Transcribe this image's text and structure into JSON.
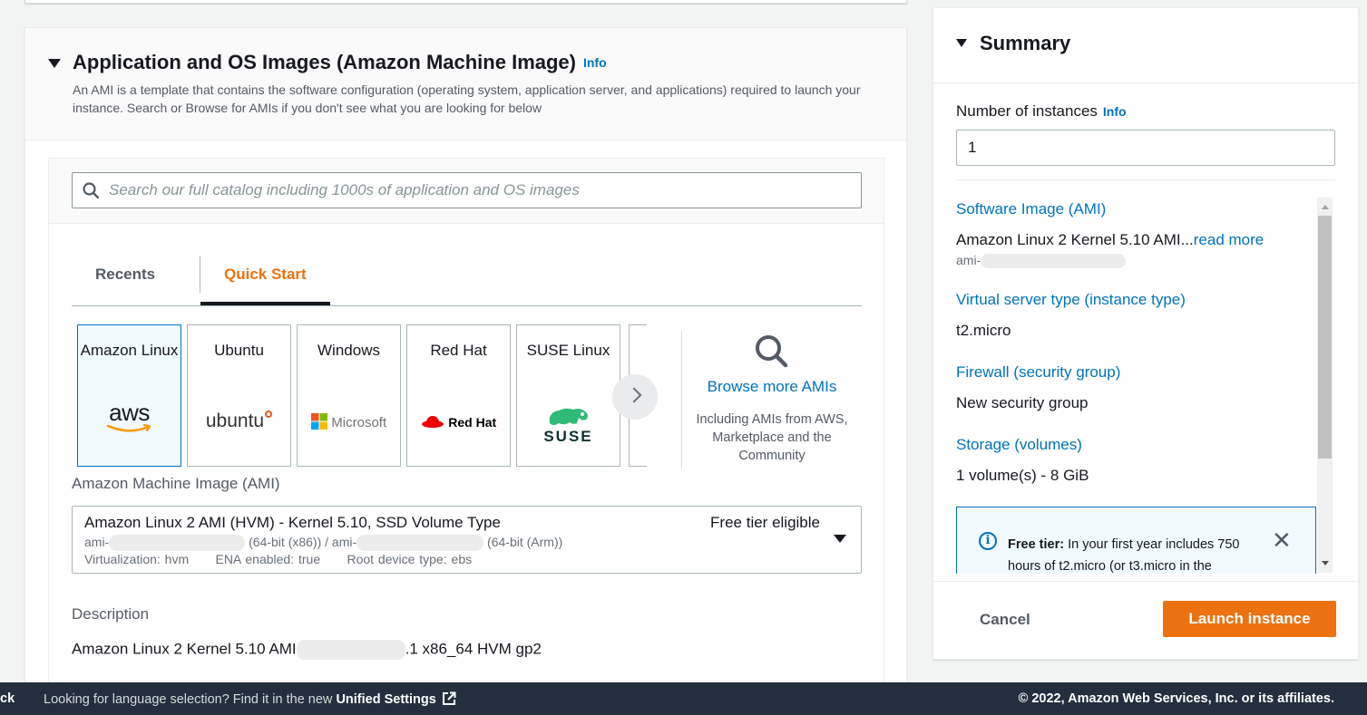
{
  "ami_section": {
    "title": "Application and OS Images (Amazon Machine Image)",
    "info": "Info",
    "description": "An AMI is a template that contains the software configuration (operating system, application server, and applications) required to launch your instance. Search or Browse for AMIs if you don't see what you are looking for below",
    "search_placeholder": "Search our full catalog including 1000s of application and OS images",
    "tabs": [
      {
        "label": "Recents"
      },
      {
        "label": "Quick Start"
      }
    ],
    "os_cards": [
      {
        "name": "Amazon Linux",
        "logo": "aws"
      },
      {
        "name": "Ubuntu",
        "logo": "ubuntu"
      },
      {
        "name": "Windows",
        "logo": "Microsoft"
      },
      {
        "name": "Red Hat",
        "logo": "Red Hat"
      },
      {
        "name": "SUSE Linux",
        "logo": "SUSE"
      }
    ],
    "browse": {
      "link": "Browse more AMIs",
      "sub": "Including AMIs from AWS, Marketplace and the Community"
    },
    "ami_label": "Amazon Machine Image (AMI)",
    "ami_select": {
      "title": "Amazon Linux 2 AMI (HVM) - Kernel 5.10, SSD Volume Type",
      "badge": "Free tier eligible",
      "id_prefix_1": "ami-",
      "arch_1": "(64-bit (x86)) / ami-",
      "arch_2": "(64-bit (Arm))",
      "virtualization": "Virtualization: hvm",
      "ena": "ENA enabled: true",
      "root_device": "Root device type: ebs"
    },
    "description_label": "Description",
    "description_prefix": "Amazon Linux 2 Kernel 5.10 AMI",
    "description_suffix": ".1 x86_64 HVM gp2"
  },
  "summary": {
    "title": "Summary",
    "num_instances_label": "Number of instances",
    "info": "Info",
    "num_instances_value": "1",
    "software_image_label": "Software Image (AMI)",
    "software_image_value": "Amazon Linux 2 Kernel 5.10 AMI...",
    "read_more": "read more",
    "ami_id_prefix": "ami-",
    "instance_type_label": "Virtual server type (instance type)",
    "instance_type_value": "t2.micro",
    "firewall_label": "Firewall (security group)",
    "firewall_value": "New security group",
    "storage_label": "Storage (volumes)",
    "storage_value": "1 volume(s) - 8 GiB",
    "free_tier_bold": "Free tier:",
    "free_tier_text": " In your first year includes 750 hours of t2.micro (or t3.micro in the",
    "cancel": "Cancel",
    "launch": "Launch instance"
  },
  "footer": {
    "feedback": "ck",
    "language_text": "Looking for language selection? Find it in the new ",
    "unified_settings": "Unified Settings",
    "copyright": "© 2022, Amazon Web Services, Inc. or its affiliates."
  },
  "colors": {
    "accent_orange": "#ec7211",
    "link_blue": "#0073bb",
    "footer_bg": "#232f3e"
  }
}
